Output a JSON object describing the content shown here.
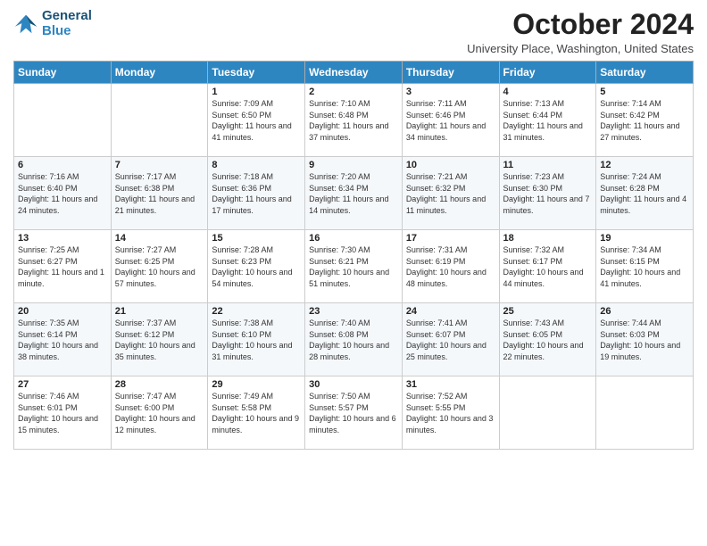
{
  "logo": {
    "line1": "General",
    "line2": "Blue"
  },
  "header": {
    "month": "October 2024",
    "location": "University Place, Washington, United States"
  },
  "weekdays": [
    "Sunday",
    "Monday",
    "Tuesday",
    "Wednesday",
    "Thursday",
    "Friday",
    "Saturday"
  ],
  "weeks": [
    [
      {
        "day": "",
        "info": ""
      },
      {
        "day": "",
        "info": ""
      },
      {
        "day": "1",
        "info": "Sunrise: 7:09 AM\nSunset: 6:50 PM\nDaylight: 11 hours and 41 minutes."
      },
      {
        "day": "2",
        "info": "Sunrise: 7:10 AM\nSunset: 6:48 PM\nDaylight: 11 hours and 37 minutes."
      },
      {
        "day": "3",
        "info": "Sunrise: 7:11 AM\nSunset: 6:46 PM\nDaylight: 11 hours and 34 minutes."
      },
      {
        "day": "4",
        "info": "Sunrise: 7:13 AM\nSunset: 6:44 PM\nDaylight: 11 hours and 31 minutes."
      },
      {
        "day": "5",
        "info": "Sunrise: 7:14 AM\nSunset: 6:42 PM\nDaylight: 11 hours and 27 minutes."
      }
    ],
    [
      {
        "day": "6",
        "info": "Sunrise: 7:16 AM\nSunset: 6:40 PM\nDaylight: 11 hours and 24 minutes."
      },
      {
        "day": "7",
        "info": "Sunrise: 7:17 AM\nSunset: 6:38 PM\nDaylight: 11 hours and 21 minutes."
      },
      {
        "day": "8",
        "info": "Sunrise: 7:18 AM\nSunset: 6:36 PM\nDaylight: 11 hours and 17 minutes."
      },
      {
        "day": "9",
        "info": "Sunrise: 7:20 AM\nSunset: 6:34 PM\nDaylight: 11 hours and 14 minutes."
      },
      {
        "day": "10",
        "info": "Sunrise: 7:21 AM\nSunset: 6:32 PM\nDaylight: 11 hours and 11 minutes."
      },
      {
        "day": "11",
        "info": "Sunrise: 7:23 AM\nSunset: 6:30 PM\nDaylight: 11 hours and 7 minutes."
      },
      {
        "day": "12",
        "info": "Sunrise: 7:24 AM\nSunset: 6:28 PM\nDaylight: 11 hours and 4 minutes."
      }
    ],
    [
      {
        "day": "13",
        "info": "Sunrise: 7:25 AM\nSunset: 6:27 PM\nDaylight: 11 hours and 1 minute."
      },
      {
        "day": "14",
        "info": "Sunrise: 7:27 AM\nSunset: 6:25 PM\nDaylight: 10 hours and 57 minutes."
      },
      {
        "day": "15",
        "info": "Sunrise: 7:28 AM\nSunset: 6:23 PM\nDaylight: 10 hours and 54 minutes."
      },
      {
        "day": "16",
        "info": "Sunrise: 7:30 AM\nSunset: 6:21 PM\nDaylight: 10 hours and 51 minutes."
      },
      {
        "day": "17",
        "info": "Sunrise: 7:31 AM\nSunset: 6:19 PM\nDaylight: 10 hours and 48 minutes."
      },
      {
        "day": "18",
        "info": "Sunrise: 7:32 AM\nSunset: 6:17 PM\nDaylight: 10 hours and 44 minutes."
      },
      {
        "day": "19",
        "info": "Sunrise: 7:34 AM\nSunset: 6:15 PM\nDaylight: 10 hours and 41 minutes."
      }
    ],
    [
      {
        "day": "20",
        "info": "Sunrise: 7:35 AM\nSunset: 6:14 PM\nDaylight: 10 hours and 38 minutes."
      },
      {
        "day": "21",
        "info": "Sunrise: 7:37 AM\nSunset: 6:12 PM\nDaylight: 10 hours and 35 minutes."
      },
      {
        "day": "22",
        "info": "Sunrise: 7:38 AM\nSunset: 6:10 PM\nDaylight: 10 hours and 31 minutes."
      },
      {
        "day": "23",
        "info": "Sunrise: 7:40 AM\nSunset: 6:08 PM\nDaylight: 10 hours and 28 minutes."
      },
      {
        "day": "24",
        "info": "Sunrise: 7:41 AM\nSunset: 6:07 PM\nDaylight: 10 hours and 25 minutes."
      },
      {
        "day": "25",
        "info": "Sunrise: 7:43 AM\nSunset: 6:05 PM\nDaylight: 10 hours and 22 minutes."
      },
      {
        "day": "26",
        "info": "Sunrise: 7:44 AM\nSunset: 6:03 PM\nDaylight: 10 hours and 19 minutes."
      }
    ],
    [
      {
        "day": "27",
        "info": "Sunrise: 7:46 AM\nSunset: 6:01 PM\nDaylight: 10 hours and 15 minutes."
      },
      {
        "day": "28",
        "info": "Sunrise: 7:47 AM\nSunset: 6:00 PM\nDaylight: 10 hours and 12 minutes."
      },
      {
        "day": "29",
        "info": "Sunrise: 7:49 AM\nSunset: 5:58 PM\nDaylight: 10 hours and 9 minutes."
      },
      {
        "day": "30",
        "info": "Sunrise: 7:50 AM\nSunset: 5:57 PM\nDaylight: 10 hours and 6 minutes."
      },
      {
        "day": "31",
        "info": "Sunrise: 7:52 AM\nSunset: 5:55 PM\nDaylight: 10 hours and 3 minutes."
      },
      {
        "day": "",
        "info": ""
      },
      {
        "day": "",
        "info": ""
      }
    ]
  ]
}
